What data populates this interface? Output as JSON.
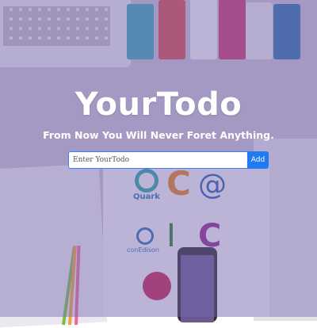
{
  "app": {
    "title": "YourTodo",
    "tagline": "From Now You Will Never Foret Anything."
  },
  "todo_form": {
    "input_placeholder": "Enter YourTodo",
    "input_value": "",
    "add_label": "Add"
  },
  "background": {
    "logos": [
      "Quark",
      "conEdison"
    ],
    "overlay_color": "#7868b4",
    "accent_color": "#1e7bf2"
  }
}
